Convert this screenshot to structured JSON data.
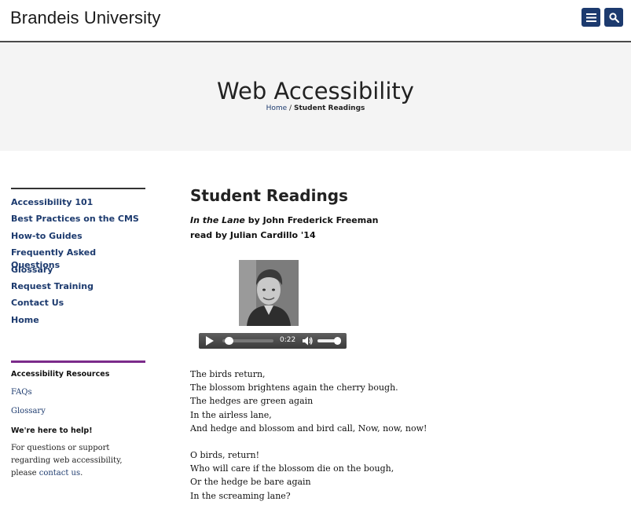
{
  "header": {
    "brand": "Brandeis University",
    "menu_icon": "hamburger-menu-icon",
    "search_icon": "search-icon",
    "accent_color": "#1c3a6e"
  },
  "hero": {
    "title": "Web Accessibility",
    "breadcrumb": {
      "home": "Home",
      "separator": "/",
      "current": "Student Readings"
    }
  },
  "sidebar": {
    "items": [
      {
        "label": "Accessibility 101"
      },
      {
        "label": "Best Practices on the CMS"
      },
      {
        "label": "How-to Guides"
      },
      {
        "label": "Frequently Asked Questions"
      },
      {
        "label": "Glossary"
      },
      {
        "label": "Request Training"
      },
      {
        "label": "Contact Us"
      },
      {
        "label": "Home"
      }
    ],
    "resources": {
      "title": "Accessibility Resources",
      "links": [
        {
          "label": "FAQs"
        },
        {
          "label": "Glossary"
        }
      ],
      "help_title": "We're here to help!",
      "help_text_prefix": "For questions or support regarding web accessibility, please ",
      "help_link": "contact us",
      "help_text_suffix": "."
    }
  },
  "main": {
    "heading": "Student Readings",
    "poem_title": "In the Lane",
    "author_line": " by John Frederick Freeman",
    "reader_line": "read by Julian Cardillo '14",
    "player": {
      "time": "0:22",
      "progress": 0.05,
      "volume": 1.0
    },
    "poem": [
      [
        "The birds return,",
        "The blossom brightens again the cherry bough.",
        "The hedges are green again",
        "In the airless lane,",
        "And hedge and blossom and bird call, Now, now, now!"
      ],
      [
        "O birds, return!",
        "Who will care if the blossom die on the bough,",
        "Or the hedge be bare again",
        "In the screaming lane?"
      ]
    ]
  }
}
